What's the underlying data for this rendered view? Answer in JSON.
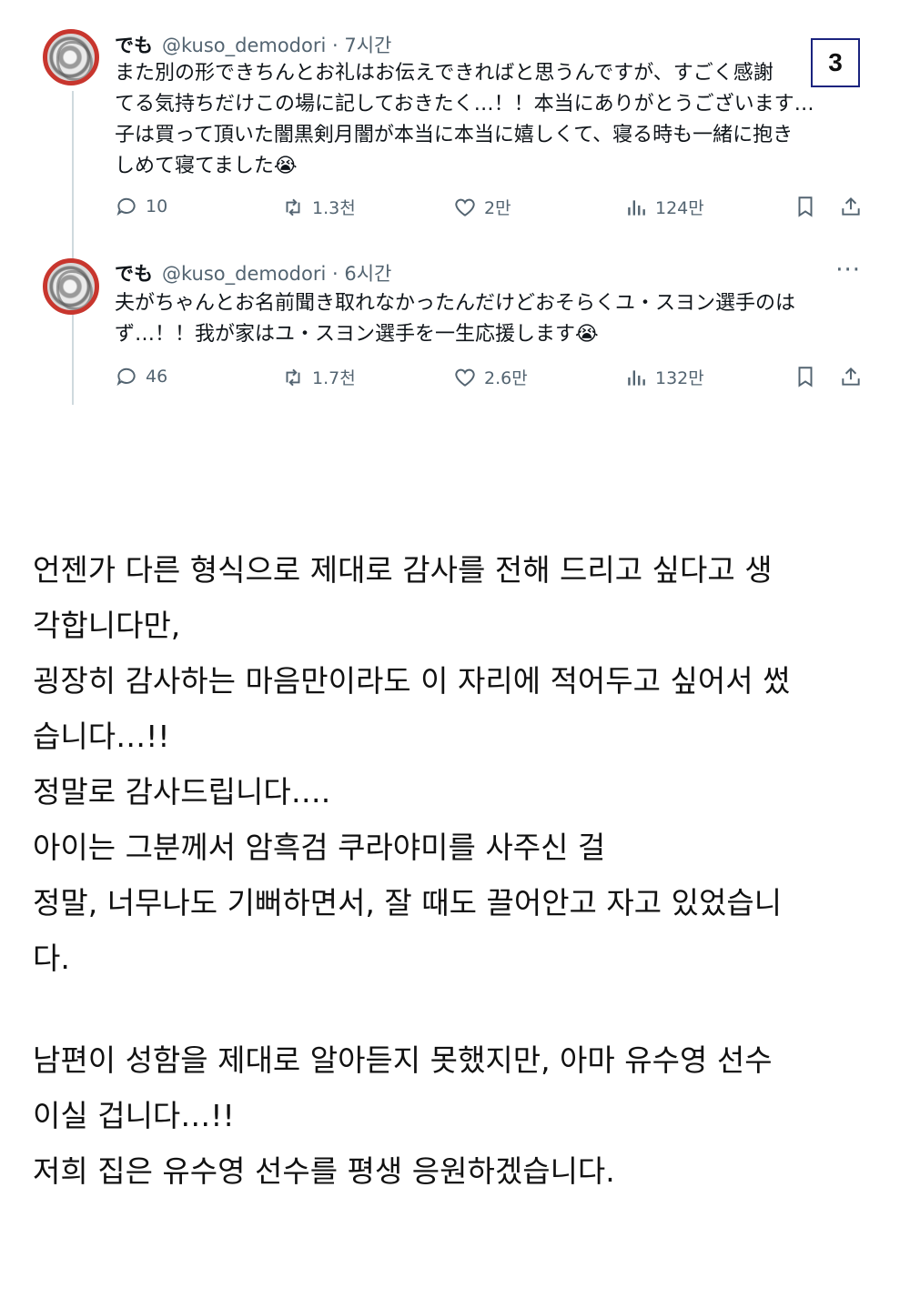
{
  "thread": {
    "tweets": [
      {
        "display_name": "でも",
        "handle": "@kuso_demodori",
        "time": "· 7시간",
        "lines": [
          "また別の形できちんとお礼はお伝えできればと思うんですが、すごく感謝",
          "てる気持ちだけこの場に記しておきたく…！！本当にありがとうございます…",
          "子は買って頂いた闇黒剣月闇が本当に本当に嬉しくて、寝る時も一緒に抱き",
          "しめて寝てました😭"
        ],
        "replies": "10",
        "reposts": "1.3천",
        "likes": "2만",
        "views": "124만"
      },
      {
        "display_name": "でも",
        "handle": "@kuso_demodori",
        "time": "· 6시간",
        "more": "···",
        "lines": [
          "夫がちゃんとお名前聞き取れなかったんだけどおそらくユ・スヨン選手のは",
          "ず…！！我が家はユ・スヨン選手を一生応援します😭"
        ],
        "replies": "46",
        "reposts": "1.7천",
        "likes": "2.6만",
        "views": "132만"
      }
    ]
  },
  "page_badge": "3",
  "translation": {
    "lines": [
      "언젠가 다른 형식으로 제대로 감사를 전해 드리고 싶다고 생",
      "각합니다만,",
      "굉장히 감사하는 마음만이라도 이 자리에 적어두고 싶어서 썼",
      "습니다…!!",
      "정말로 감사드립니다….",
      "아이는 그분께서 암흑검 쿠라야미를 사주신 걸",
      "정말, 너무나도 기뻐하면서, 잘 때도 끌어안고 자고 있었습니",
      "다.",
      "남편이 성함을 제대로 알아듣지 못했지만, 아마 유수영 선수",
      "이실 겁니다…!!",
      "저희 집은 유수영 선수를 평생 응원하겠습니다."
    ]
  },
  "icons": {
    "reply": "reply-icon",
    "repost": "repost-icon",
    "like": "heart-icon",
    "views": "views-icon",
    "bookmark": "bookmark-icon",
    "share": "share-icon"
  }
}
